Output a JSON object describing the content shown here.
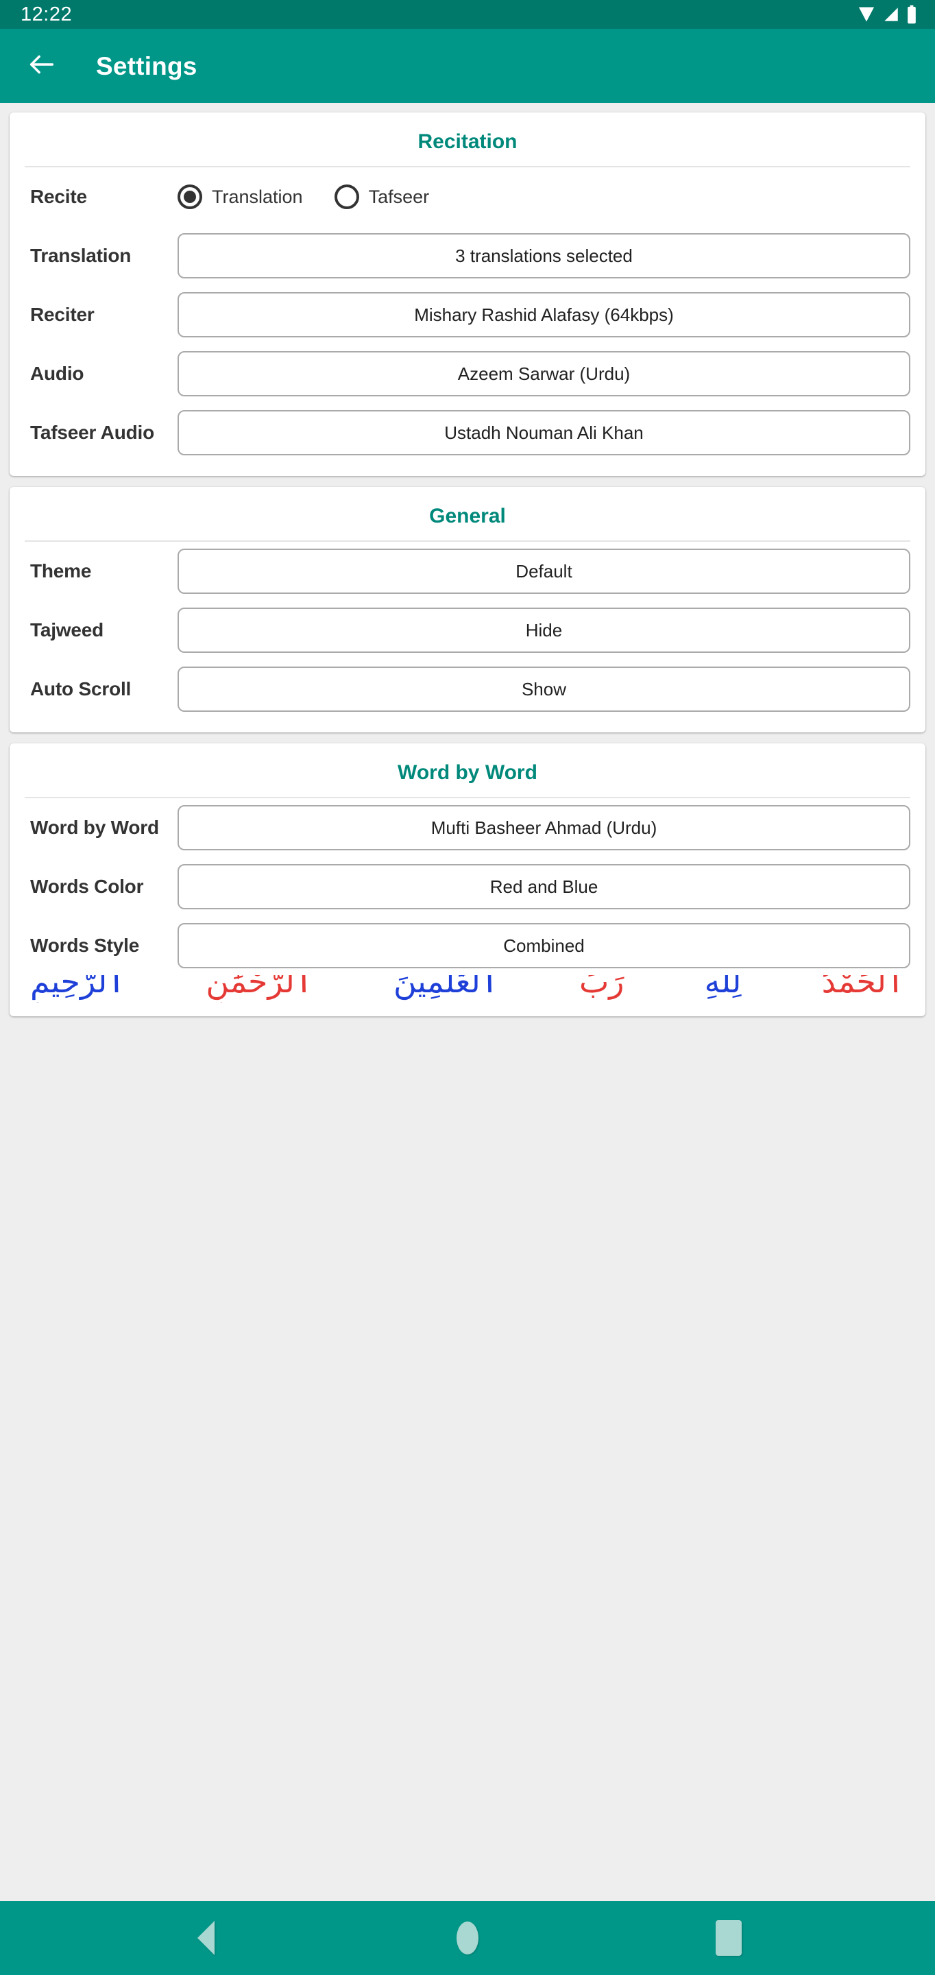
{
  "status_bar": {
    "time": "12:22",
    "icons": [
      "wifi-icon",
      "signal-icon",
      "battery-icon"
    ]
  },
  "app_bar": {
    "back_icon": "arrow-left-icon",
    "title": "Settings"
  },
  "theme_colors": {
    "primary": "#009688",
    "primary_dark": "#00796b",
    "accent_heading": "#00897b",
    "page_background": "#eeeeee",
    "card_background": "#ffffff",
    "label_text": "#333333",
    "value_border": "#aaaaaa",
    "nav_icon": "#a8d8d1",
    "word_red": "#e53935",
    "word_blue": "#1e40d8"
  },
  "sections": [
    {
      "title": "Recitation",
      "rows": [
        {
          "label": "Recite",
          "type": "radio",
          "options": [
            {
              "label": "Translation",
              "selected": true
            },
            {
              "label": "Tafseer",
              "selected": false
            }
          ]
        },
        {
          "label": "Translation",
          "type": "value",
          "value": "3 translations selected"
        },
        {
          "label": "Reciter",
          "type": "value",
          "value": "Mishary Rashid Alafasy (64kbps)"
        },
        {
          "label": "Audio",
          "type": "value",
          "value": "Azeem Sarwar (Urdu)"
        },
        {
          "label": "Tafseer Audio",
          "type": "value",
          "value": "Ustadh Nouman Ali Khan"
        }
      ]
    },
    {
      "title": "General",
      "rows": [
        {
          "label": "Theme",
          "type": "value",
          "value": "Default"
        },
        {
          "label": "Tajweed",
          "type": "value",
          "value": "Hide"
        },
        {
          "label": "Auto Scroll",
          "type": "value",
          "value": "Show"
        }
      ]
    },
    {
      "title": "Word by Word",
      "rows": [
        {
          "label": "Word by Word",
          "type": "value",
          "value": "Mufti Basheer Ahmad (Urdu)"
        },
        {
          "label": "Words Color",
          "type": "value",
          "value": "Red and Blue"
        },
        {
          "label": "Words Style",
          "type": "value",
          "value": "Combined"
        }
      ],
      "preview_words": [
        {
          "text": "ٱلْحَمْدُ",
          "color": "red"
        },
        {
          "text": "لِلَّهِ",
          "color": "blue"
        },
        {
          "text": "رَبِّ",
          "color": "red"
        },
        {
          "text": "ٱلْعَٰلَمِينَ",
          "color": "blue"
        },
        {
          "text": "ٱلرَّحْمَٰنِ",
          "color": "red"
        },
        {
          "text": "ٱلرَّحِيمِ",
          "color": "blue"
        }
      ]
    }
  ],
  "nav_bar": {
    "buttons": [
      {
        "name": "back-triangle-icon"
      },
      {
        "name": "home-circle-icon"
      },
      {
        "name": "recents-square-icon"
      }
    ]
  }
}
